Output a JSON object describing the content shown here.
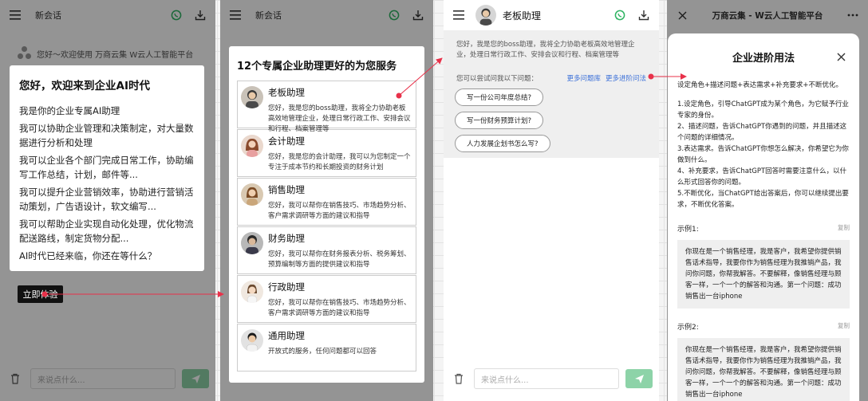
{
  "panel1": {
    "header_title": "新会话",
    "welcome_line": "您好～欢迎使用 万商云集 W云人工智能平台",
    "intro": {
      "heading": "您好，欢迎来到企业AI时代",
      "lines": [
        "我是你的企业专属AI助理",
        "我可以协助企业管理和决策制定，对大量数据进行分析和处理",
        "我可以企业各个部门完成日常工作，协助编写工作总结，计划，邮件等...",
        "我可以提升企业营销效率，协助进行营销活动策划，广告语设计，软文编写...",
        "我可以帮助企业实现自动化处理，优化物流配送路线，制定货物分配...",
        "AI时代已经来临，你还在等什么？"
      ]
    },
    "try_button": "立即体验",
    "input_placeholder": "来说点什么..."
  },
  "panel2": {
    "header_title": "新会话",
    "card_heading": "12个专属企业助理更好的为您服务",
    "assistants": [
      {
        "name": "老板助理",
        "desc": "您好，我是您的boss助理，我将全力协助老板高效地管理企业，处理日常行政工作、安排会议和行程、档案管理等"
      },
      {
        "name": "会计助理",
        "desc": "您好，我是您的会计助理，我可以为您制定一个专注于成本节约和长期投资的财务计划"
      },
      {
        "name": "销售助理",
        "desc": "您好，我可以帮你在销售技巧、市场趋势分析、客户需求调研等方面的建议和指导"
      },
      {
        "name": "财务助理",
        "desc": "您好，我可以帮你在财务报表分析、税务筹划、预算编制等方面的提供建议和指导"
      },
      {
        "name": "行政助理",
        "desc": "您好，我可以帮你在销售技巧、市场趋势分析、客户需求调研等方面的建议和指导"
      },
      {
        "name": "通用助理",
        "desc": "开放式的服务，任何问题都可以回答"
      }
    ],
    "input_placeholder": "来说点什么..."
  },
  "panel3": {
    "header_title": "老板助理",
    "greeting": "您好，我是您的boss助理，我将全力协助老板高效地管理企业，处理日常行政工作、安排会议和行程、档案管理等",
    "try_label": "您可以尝试问我以下问题：",
    "link_more_questions": "更多问题库",
    "link_advanced": "更多进阶问法",
    "suggestions": [
      "写一份公司年度总结?",
      "写一份财务预算计划?",
      "人力发展企划书怎么写?"
    ],
    "input_placeholder": "来说点什么..."
  },
  "panel4": {
    "header_title": "万商云集 - W云人工智能平台",
    "sheet_title": "企业进阶用法",
    "formula": "设定角色+描述问题+表达需求+补充要求+不断优化。",
    "steps": [
      "1.设定角色，引导ChatGPT成为某个角色，为它赋予行业专家的身份。",
      "2、描述问题，告诉ChatGPT你遇到的问题，并且描述这个问题的详细情况。",
      "3.表达需求。告诉ChatGPT你想怎么解决，你希望它为你做到什么。",
      "4、补充要求，告诉ChatGPT回答时需要注意什么，以什么形式回答你的问题。",
      "5.不断优化，当ChatGPT给出答案后，你可以继续提出要求，不断优化答案。"
    ],
    "examples": [
      {
        "label": "示例1:",
        "copy": "复制",
        "text": "你现在是一个销售经理，我是客户，我希望你提供销售话术指导，我要你作为销售经理为我推销产品，我问你问题，你帮我解答。不要解释，像销售经理与顾客一样，一个一个的解答和沟通。第一个问题：成功销售出一台iphone"
      },
      {
        "label": "示例2:",
        "copy": "复制",
        "text": "你现在是一个销售经理，我是客户，我希望你提供销售话术指导，我要你作为销售经理为我推销产品，我问你问题，你帮我解答。不要解释，像销售经理与顾客一样，一个一个的解答和沟通。第一个问题：成功销售出一台iphone"
      }
    ]
  },
  "colors": {
    "accent_green": "#2fb463",
    "send_green": "#8dd3a8",
    "arrow_red": "#e8314a",
    "link_blue": "#3a6fd8"
  }
}
